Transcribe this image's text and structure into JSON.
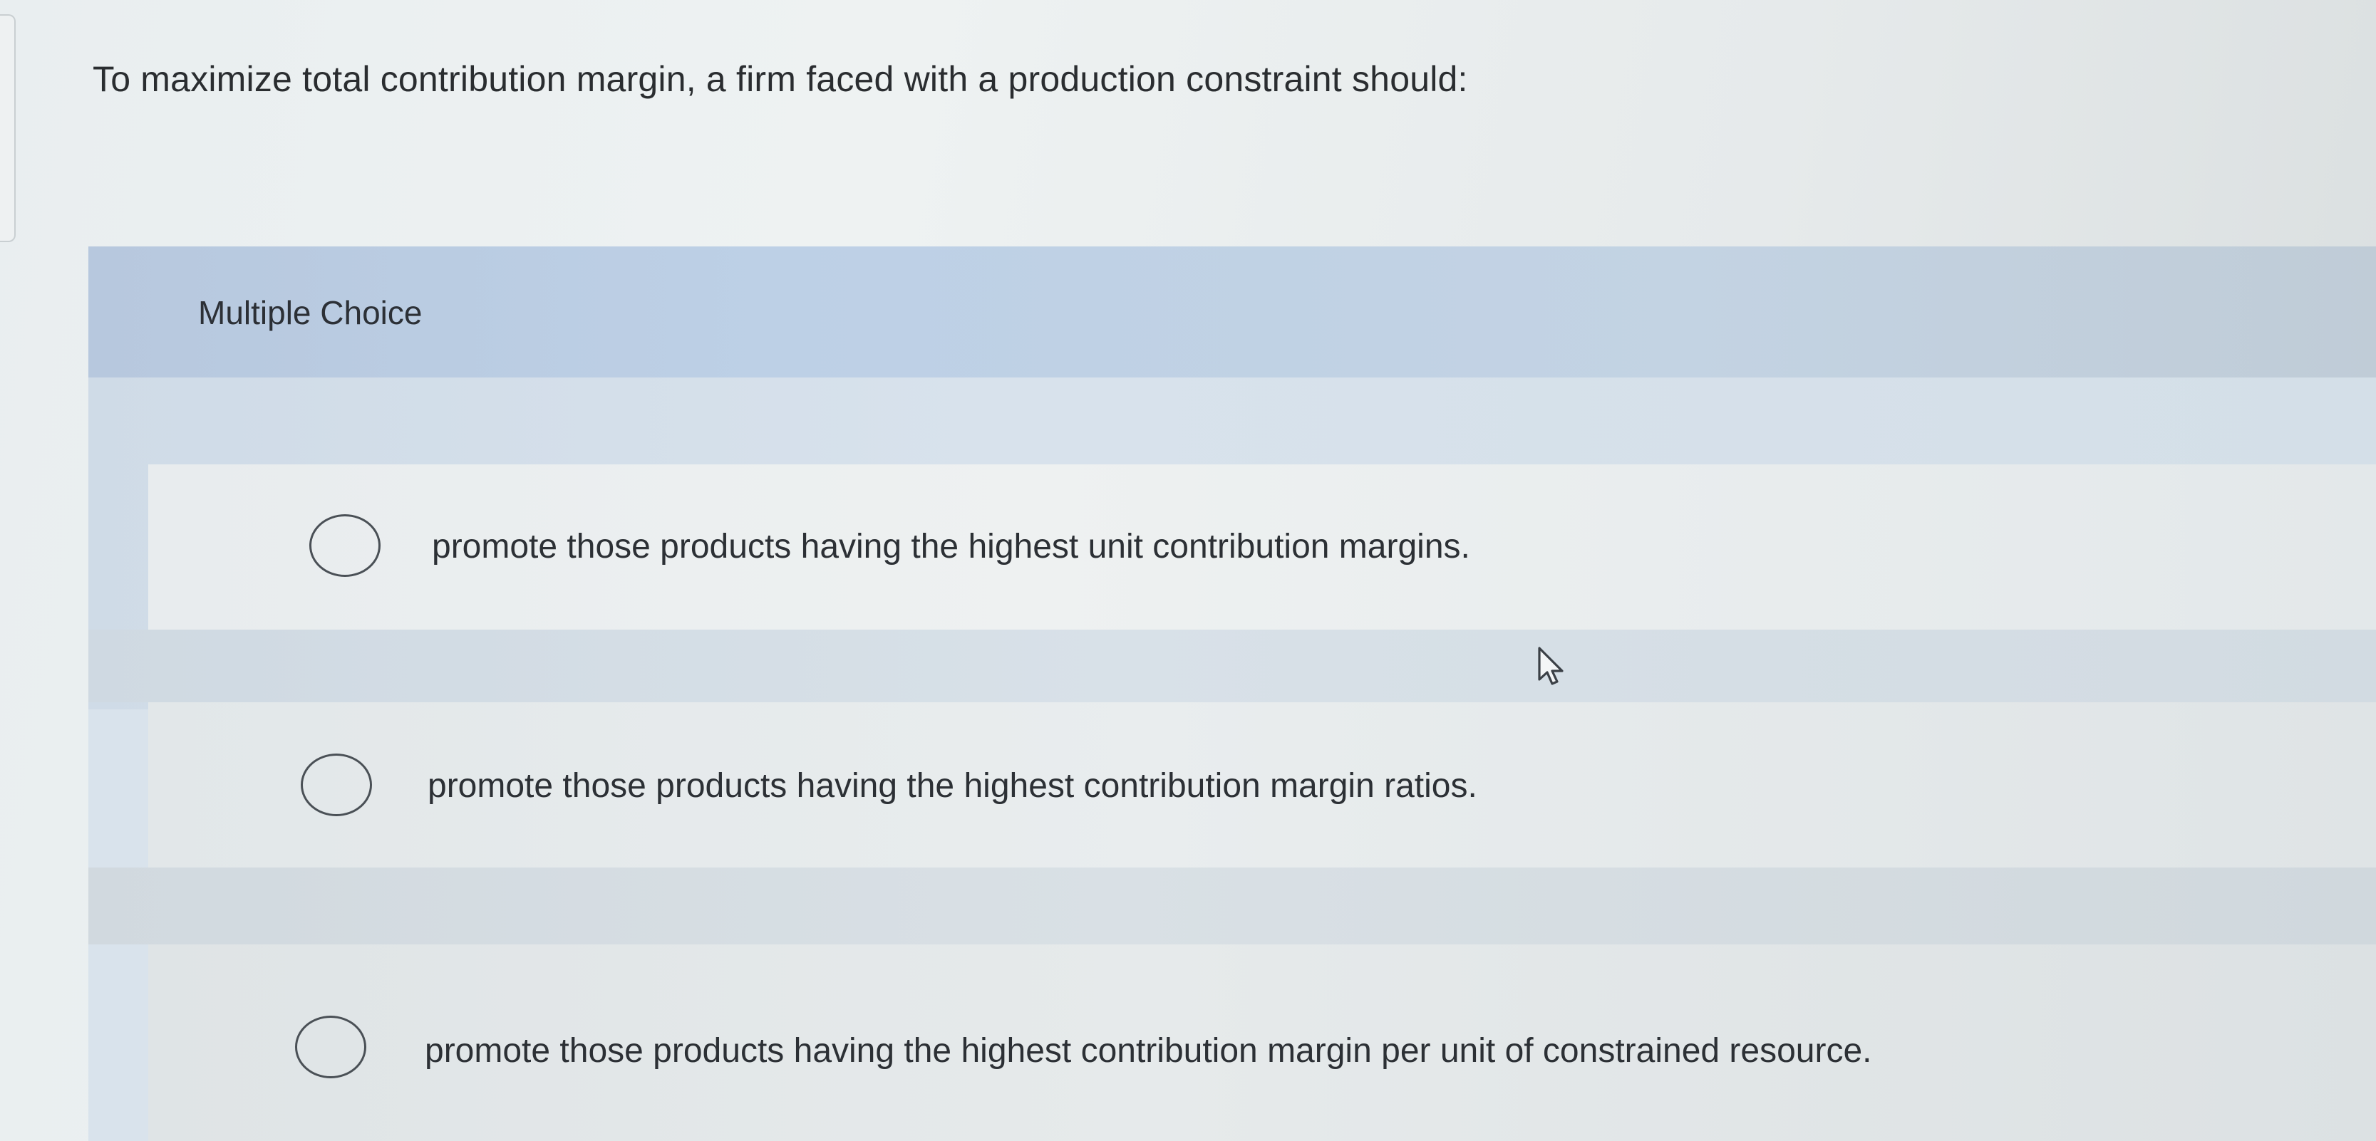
{
  "question": {
    "text": "To maximize total contribution margin, a firm faced with a production constraint should:"
  },
  "multiple_choice": {
    "label": "Multiple Choice",
    "options": [
      {
        "text": "promote those products having the highest unit contribution margins.",
        "selected": false
      },
      {
        "text": "promote those products having the highest contribution margin ratios.",
        "selected": false
      },
      {
        "text": "promote those products having the highest contribution margin per unit of constrained resource.",
        "selected": false
      }
    ]
  },
  "icons": {
    "radio": "radio-button-unchecked-icon",
    "cursor": "mouse-pointer-icon"
  },
  "colors": {
    "header_band": "#bdd0e6",
    "option_background": "#e8ecee",
    "text": "#2c3035"
  }
}
